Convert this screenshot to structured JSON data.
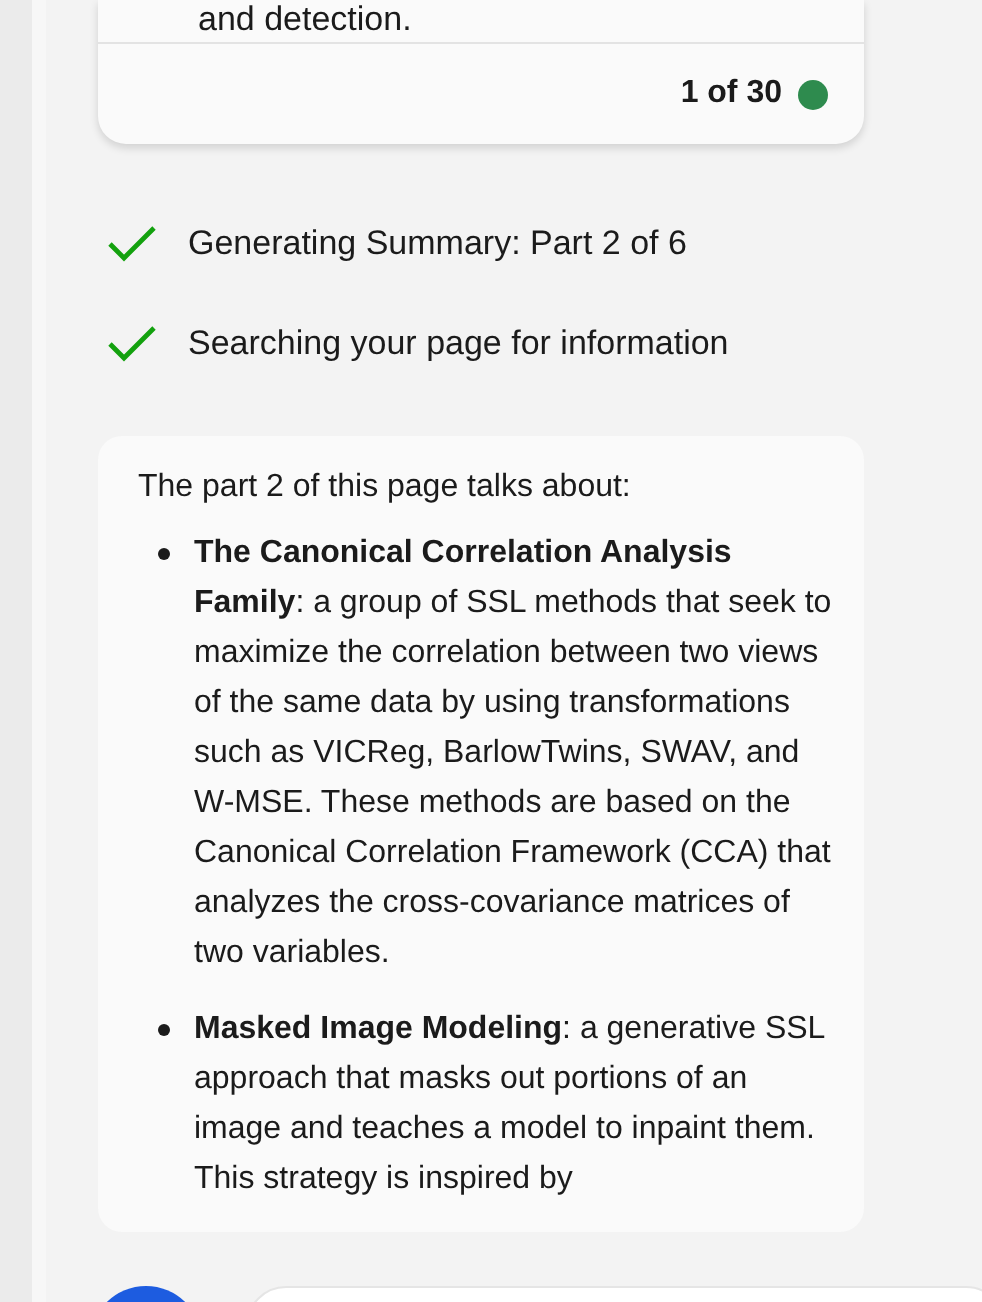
{
  "source_card": {
    "text_tail": "and detection.",
    "counter": "1 of 30"
  },
  "steps": [
    {
      "label": "Generating Summary: Part 2 of 6",
      "done": true
    },
    {
      "label": "Searching your page for information",
      "done": true
    }
  ],
  "summary": {
    "intro": "The part 2 of this page talks about:",
    "bullets": [
      {
        "text": "**The Canonical Correlation Analysis Family**: a group of SSL methods that seek to maximize the correlation between two views of the same data by using transformations such as VICReg, BarlowTwins, SWAV, and W-MSE. These methods are based on the Canonical Correlation Framework (CCA) that analyzes the cross-covariance matrices of two variables."
      },
      {
        "text": "**Masked Image Modeling**: a generative SSL approach that masks out portions of an image and teaches a model to inpaint them. This strategy is inspired by"
      }
    ]
  }
}
